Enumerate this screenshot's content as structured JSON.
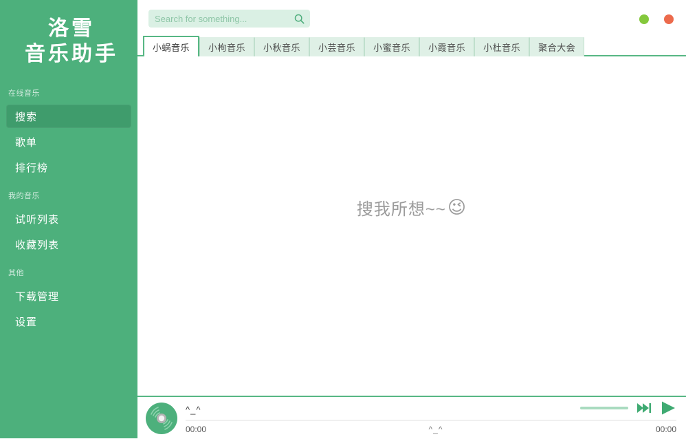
{
  "app": {
    "logo_line1": "洛雪",
    "logo_line2": "音乐助手"
  },
  "colors": {
    "sidebar_green": "#4db07c",
    "sidebar_active": "#3f9c6c",
    "accent_green": "#57b784",
    "tab_inactive_bg": "#dff0e6",
    "search_bg": "#daf0e4",
    "win_min_dot": "#84c83c",
    "win_close_dot": "#ec6a4c"
  },
  "sidebar": {
    "groups": [
      {
        "title": "在线音乐",
        "items": [
          {
            "label": "搜索",
            "active": true,
            "name": "sidebar-item-search"
          },
          {
            "label": "歌单",
            "active": false,
            "name": "sidebar-item-songlist"
          },
          {
            "label": "排行榜",
            "active": false,
            "name": "sidebar-item-leaderboard"
          }
        ]
      },
      {
        "title": "我的音乐",
        "items": [
          {
            "label": "试听列表",
            "active": false,
            "name": "sidebar-item-preview-list"
          },
          {
            "label": "收藏列表",
            "active": false,
            "name": "sidebar-item-favorites"
          }
        ]
      },
      {
        "title": "其他",
        "items": [
          {
            "label": "下载管理",
            "active": false,
            "name": "sidebar-item-downloads"
          },
          {
            "label": "设置",
            "active": false,
            "name": "sidebar-item-settings"
          }
        ]
      }
    ]
  },
  "search": {
    "placeholder": "Search for something...",
    "value": "",
    "icon": "search-icon"
  },
  "window_controls": {
    "minimize_icon": "minimize-dot-icon",
    "close_icon": "close-dot-icon"
  },
  "tabs": [
    {
      "label": "小蜗音乐",
      "active": true
    },
    {
      "label": "小枸音乐",
      "active": false
    },
    {
      "label": "小秋音乐",
      "active": false
    },
    {
      "label": "小芸音乐",
      "active": false
    },
    {
      "label": "小蜜音乐",
      "active": false
    },
    {
      "label": "小霞音乐",
      "active": false
    },
    {
      "label": "小杜音乐",
      "active": false
    },
    {
      "label": "聚合大会",
      "active": false
    }
  ],
  "content": {
    "empty_text": "搜我所想~~",
    "empty_emoji": "😉"
  },
  "player": {
    "song_title": "^_^",
    "lyric": "^_^",
    "time_current": "00:00",
    "time_duration": "00:00",
    "progress_percent": 0,
    "volume_percent": 100,
    "album_art_icon": "cd-disc-icon",
    "next_label": "next-track-icon",
    "play_label": "play-icon"
  }
}
